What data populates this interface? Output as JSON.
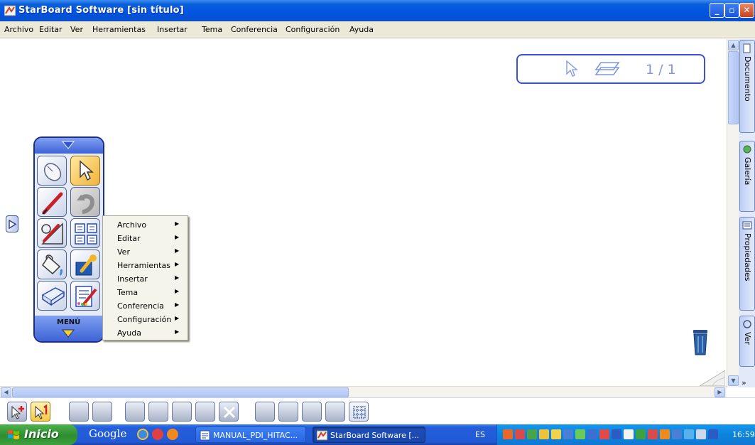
{
  "window": {
    "title": "StarBoard Software [sin título]"
  },
  "menubar": [
    "Archivo",
    "Editar",
    "Ver",
    "Herramientas",
    "Insertar",
    "Tema",
    "Conferencia",
    "Configuración",
    "Ayuda"
  ],
  "page_indicator": {
    "text": "1 / 1"
  },
  "right_tabs": [
    "Documento",
    "Galería",
    "Propiedades",
    "Ver"
  ],
  "toolbox": {
    "menu_label": "MENÚ"
  },
  "context_menu": [
    "Archivo",
    "Editar",
    "Ver",
    "Herramientas",
    "Insertar",
    "Tema",
    "Conferencia",
    "Configuración",
    "Ayuda"
  ],
  "taskbar": {
    "start_label": "Inicio",
    "google_label": "Google",
    "tasks": [
      "MANUAL_PDI_HITAC...",
      "StarBoard Software [..."
    ],
    "language": "ES",
    "clock": "16:59"
  },
  "colors": {
    "title_bar": "#0054e3",
    "accent_border": "#3b50d8",
    "taskbar": "#245edb",
    "start_button": "#3ea13e"
  },
  "icons": [
    "starboard-app-icon",
    "pointer-icon",
    "page-layers-icon",
    "trash-icon",
    "mouse-icon",
    "pen-icon",
    "undo-icon",
    "eraser-pen-icon",
    "grid-icon",
    "bucket-icon",
    "wrench-icon",
    "roll-icon",
    "settings-pen-icon"
  ]
}
